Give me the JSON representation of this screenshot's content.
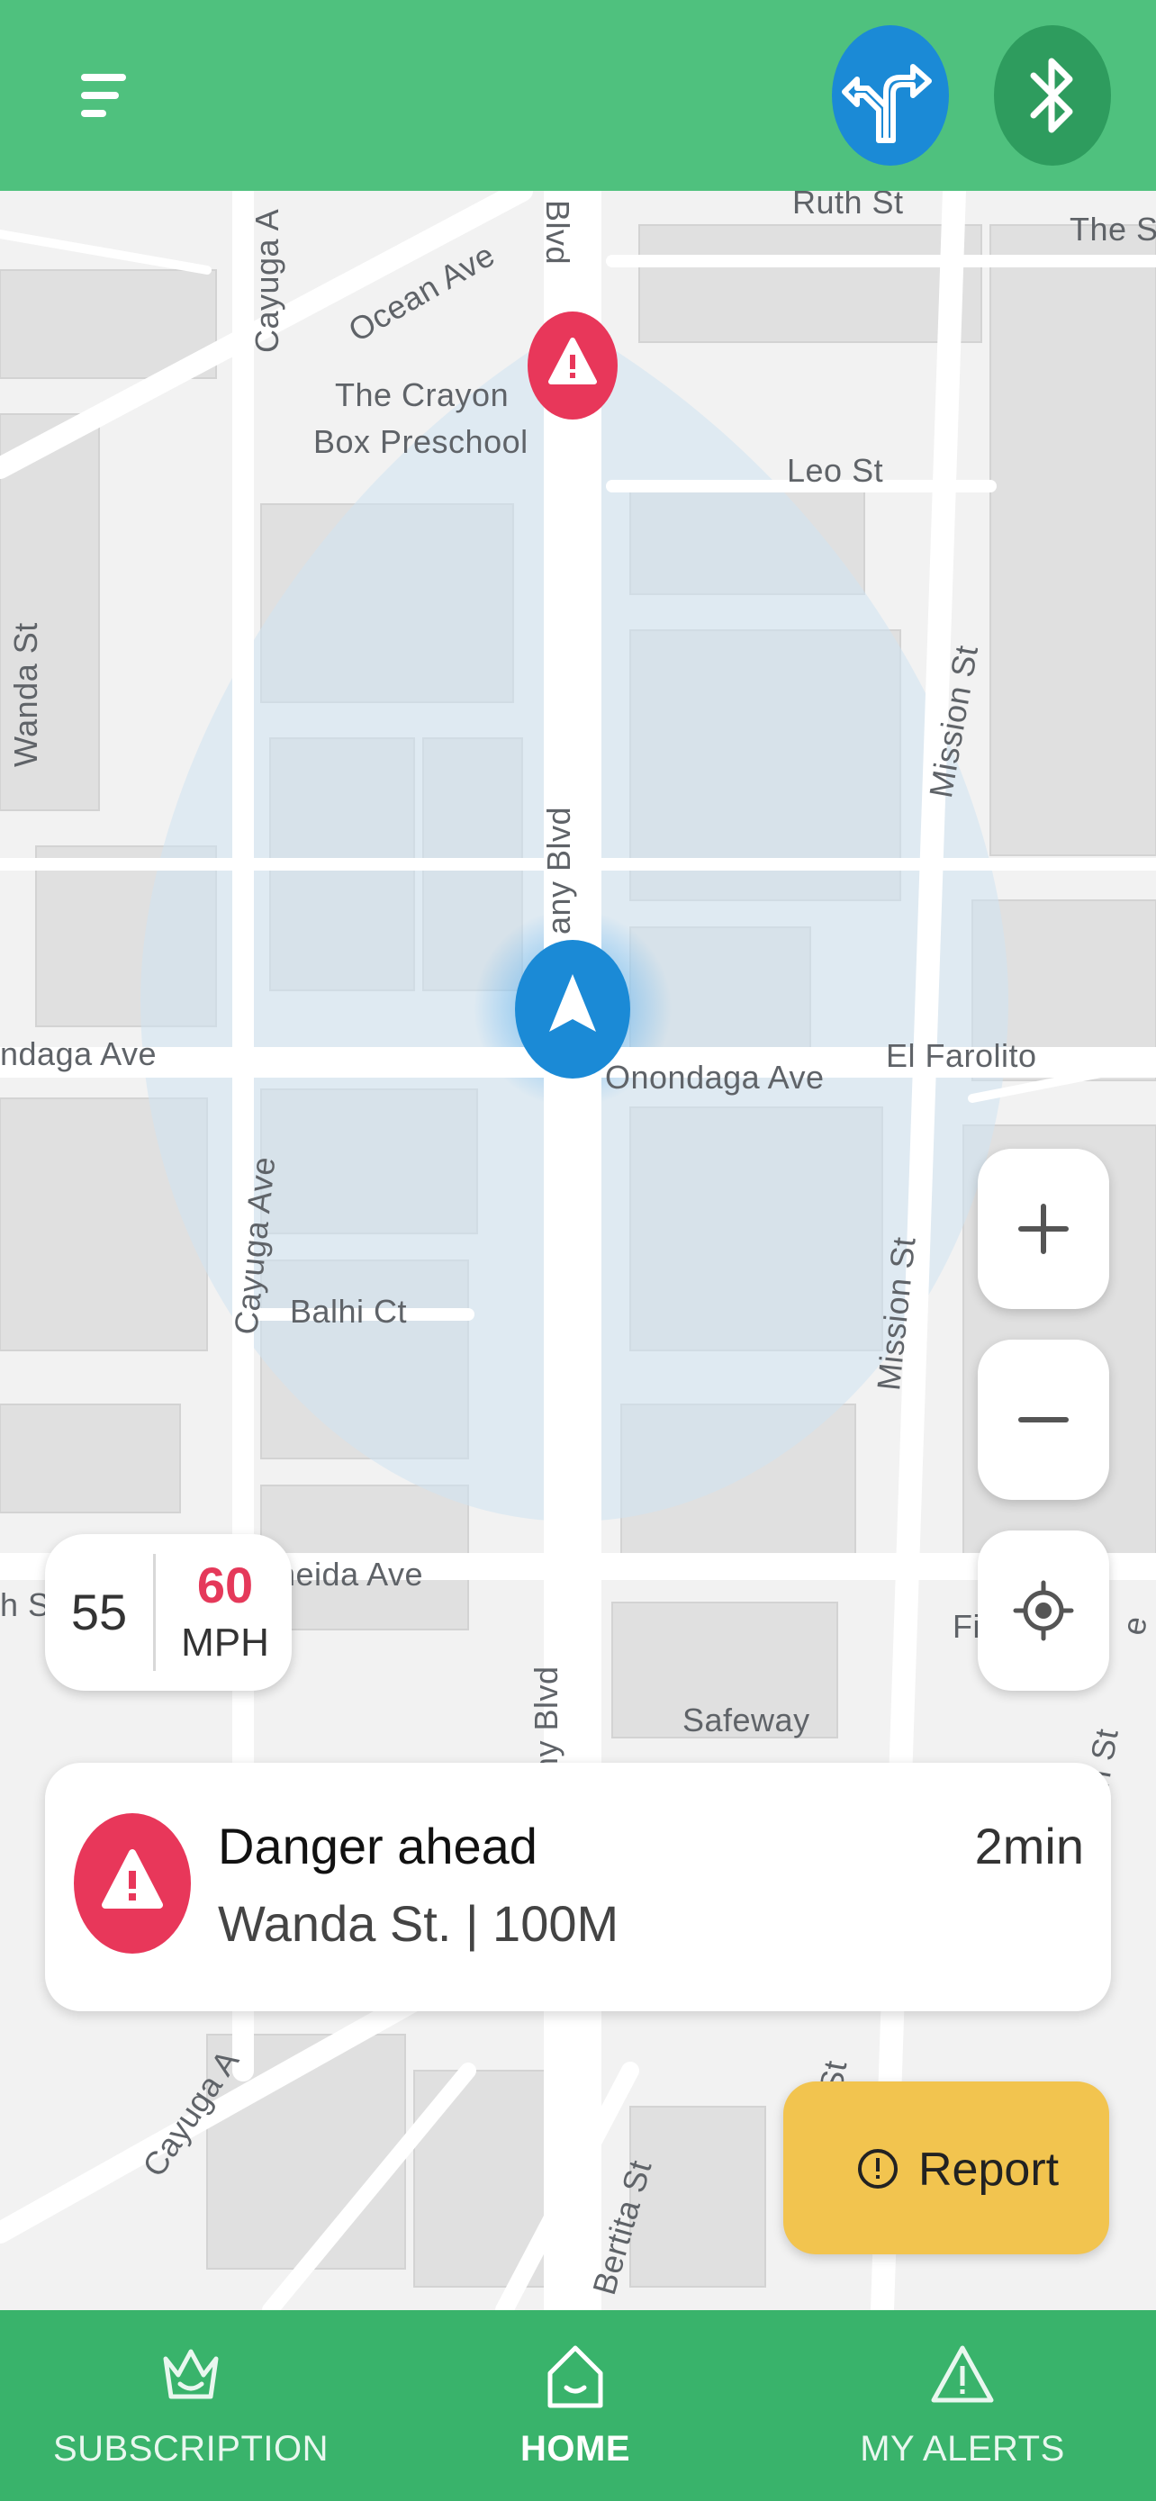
{
  "topbar": {
    "menu_icon": "menu-icon",
    "route_icon": "route-split-icon",
    "bluetooth_icon": "bluetooth-icon",
    "colors": {
      "bar": "#4fc17e",
      "route": "#1b8ad6",
      "bluetooth": "#2e9c5e"
    }
  },
  "map": {
    "streets": {
      "ruth": "Ruth St",
      "the_s": "The S",
      "ocean": "Ocean Ave",
      "blvd_top": "Blvd",
      "cayuga_top": "Cayuga A",
      "crayon_1": "The Crayon",
      "crayon_2": "Box Preschool",
      "leo": "Leo St",
      "wanda": "Wanda St",
      "mission_top": "Mission St",
      "any_blvd": "any Blvd",
      "nondaga": "ndaga Ave",
      "onondaga": "Onondaga Ave",
      "el_farolito": "El Farolito",
      "cayuga_mid": "Cayuga Ave",
      "balhi": "Balhi Ct",
      "mission_mid": "Mission St",
      "neida": "neida Ave",
      "h_s": "h S",
      "f_frag": "Fi",
      "e_frag": "e",
      "ny_blvd": "ny Blvd",
      "safeway": "Safeway",
      "n_st": "n St",
      "cayuga_bot": "Cayuga A",
      "st_frag": "St",
      "bertita": "Bertita St"
    },
    "hazard_icon": "warning-marker-icon",
    "location_icon": "navigation-arrow-icon"
  },
  "controls": {
    "zoom_in_icon": "plus-icon",
    "zoom_out_icon": "minus-icon",
    "locate_icon": "my-location-icon"
  },
  "speed": {
    "current": "55",
    "limit": "60",
    "unit": "MPH"
  },
  "alert": {
    "title": "Danger ahead",
    "location": "Wanda St. | 100M",
    "eta": "2min",
    "icon": "warning-icon",
    "color": "#e8375a"
  },
  "report": {
    "label": "Report",
    "icon": "exclamation-circle-icon",
    "color": "#f2c44f"
  },
  "nav": {
    "items": [
      {
        "label": "SUBSCRIPTION",
        "icon": "crown-icon"
      },
      {
        "label": "HOME",
        "icon": "home-icon"
      },
      {
        "label": "MY ALERTS",
        "icon": "alert-triangle-icon"
      }
    ],
    "active": "HOME",
    "color": "#39b36b"
  }
}
